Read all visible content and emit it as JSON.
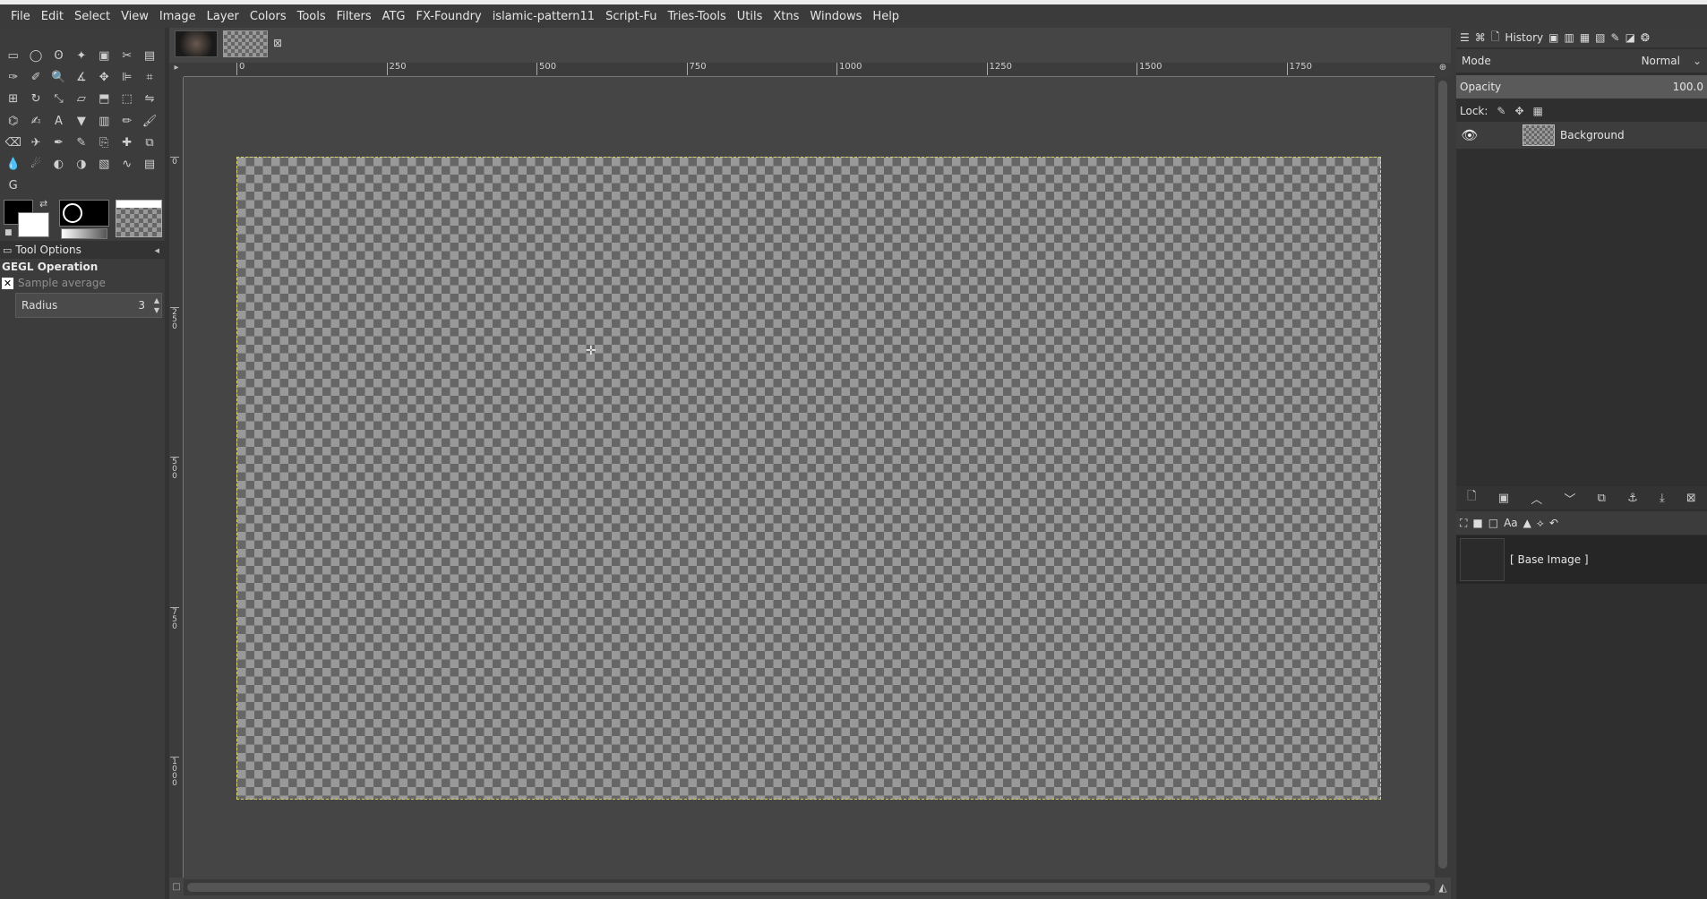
{
  "menu": [
    "File",
    "Edit",
    "Select",
    "View",
    "Image",
    "Layer",
    "Colors",
    "Tools",
    "Filters",
    "ATG",
    "FX-Foundry",
    "islamic-pattern11",
    "Script-Fu",
    "Tries-Tools",
    "Utils",
    "Xtns",
    "Windows",
    "Help"
  ],
  "toolbox": {
    "tool_icons": [
      "rect-select",
      "ellipse-select",
      "free-select",
      "fuzzy-select",
      "select-by-color",
      "scissors",
      "foreground-select",
      "paths",
      "color-picker",
      "zoom",
      "measure",
      "move",
      "align",
      "crop",
      "unified-transform",
      "rotate",
      "scale",
      "shear",
      "perspective",
      "3d-transform",
      "flip",
      "cage",
      "warp",
      "text",
      "bucket-fill",
      "gradient",
      "pencil",
      "paintbrush",
      "eraser",
      "airbrush",
      "ink",
      "mypaint",
      "clone",
      "heal",
      "perspective-clone",
      "blur",
      "smudge",
      "dodge-burn",
      "contrast",
      "levels",
      "curves",
      "histogram",
      "gegl"
    ],
    "tool_options_tab": "Tool Options",
    "gegl_title": "GEGL Operation",
    "sample_average_label": "Sample average",
    "radius_label": "Radius",
    "radius_value": "3"
  },
  "rulers": {
    "h_ticks": [
      "0",
      "250",
      "500",
      "750",
      "1000",
      "1250",
      "1500",
      "1750"
    ],
    "v_ticks": [
      "0",
      "250",
      "500",
      "750",
      "1000"
    ]
  },
  "right_dock": {
    "history_tab": "History",
    "mode_label": "Mode",
    "mode_value": "Normal",
    "opacity_label": "Opacity",
    "opacity_value": "100.0",
    "lock_label": "Lock:",
    "layers": [
      {
        "name": "Background"
      }
    ],
    "channel_name": "[ Base Image ]"
  }
}
